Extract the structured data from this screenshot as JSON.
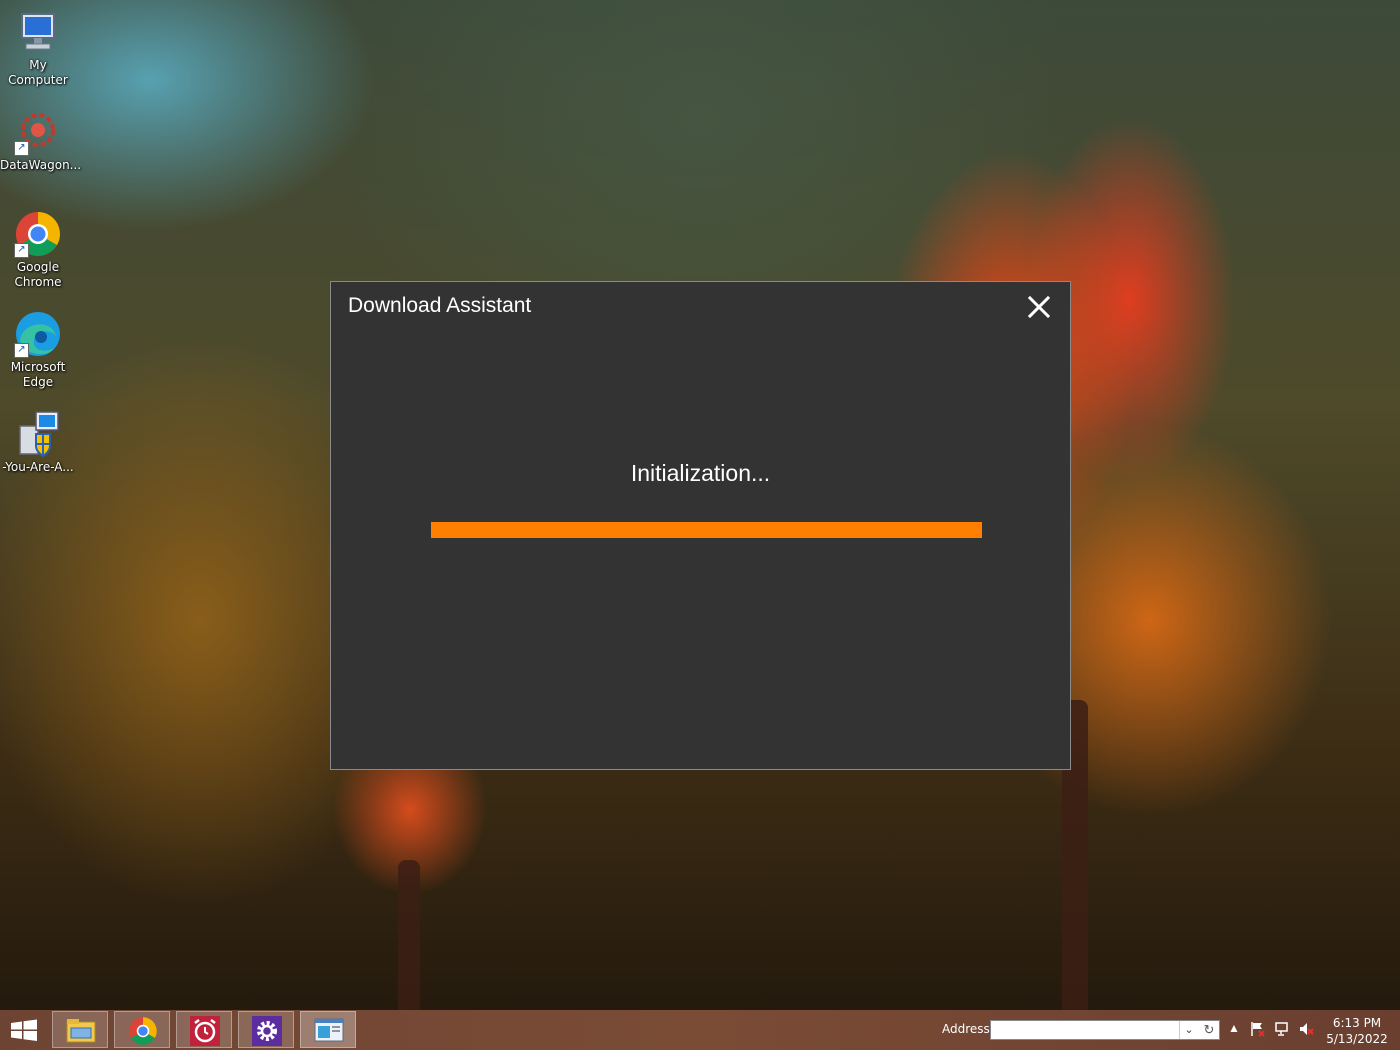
{
  "desktop": {
    "icons": [
      {
        "label_line1": "My",
        "label_line2": "Computer",
        "icon": "computer-icon"
      },
      {
        "label_line1": "DataWagon...",
        "label_line2": "",
        "icon": "datawagon-icon"
      },
      {
        "label_line1": "Google",
        "label_line2": "Chrome",
        "icon": "chrome-icon"
      },
      {
        "label_line1": "Microsoft",
        "label_line2": "Edge",
        "icon": "edge-icon"
      },
      {
        "label_line1": "-You-Are-A...",
        "label_line2": "",
        "icon": "installer-icon"
      }
    ]
  },
  "dialog": {
    "title": "Download Assistant",
    "status": "Initialization...",
    "progress_percent": 100,
    "accent_color": "#ff7f00",
    "background_color": "#333333"
  },
  "taskbar": {
    "pinned": [
      "file-explorer-icon",
      "chrome-icon",
      "alarm-clock-icon",
      "settings-icon",
      "window-app-icon"
    ],
    "address_label": "Address",
    "address_value": "",
    "time": "6:13 PM",
    "date": "5/13/2022"
  }
}
